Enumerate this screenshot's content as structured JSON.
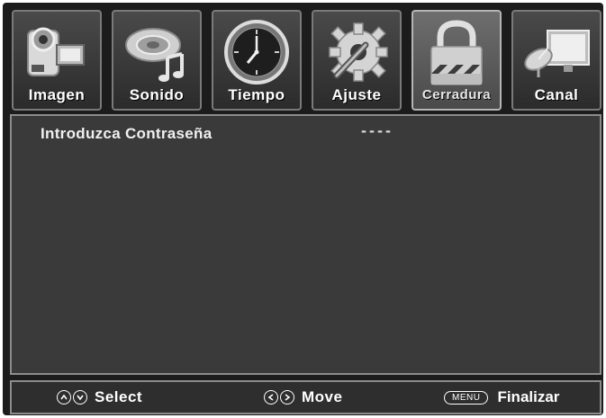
{
  "tabs": [
    {
      "label": "Imagen",
      "icon": "camcorder-icon",
      "active": false
    },
    {
      "label": "Sonido",
      "icon": "speaker-music-icon",
      "active": false
    },
    {
      "label": "Tiempo",
      "icon": "clock-icon",
      "active": false
    },
    {
      "label": "Ajuste",
      "icon": "gear-wrench-icon",
      "active": false
    },
    {
      "label": "Cerradura",
      "icon": "padlock-icon",
      "active": true
    },
    {
      "label": "Canal",
      "icon": "satellite-tv-icon",
      "active": false
    }
  ],
  "panel": {
    "prompt": "Introduzca Contraseña",
    "password_mask": "----"
  },
  "footer": {
    "select_label": "Select",
    "move_label": "Move",
    "menu_key": "MENU",
    "exit_label": "Finalizar"
  }
}
